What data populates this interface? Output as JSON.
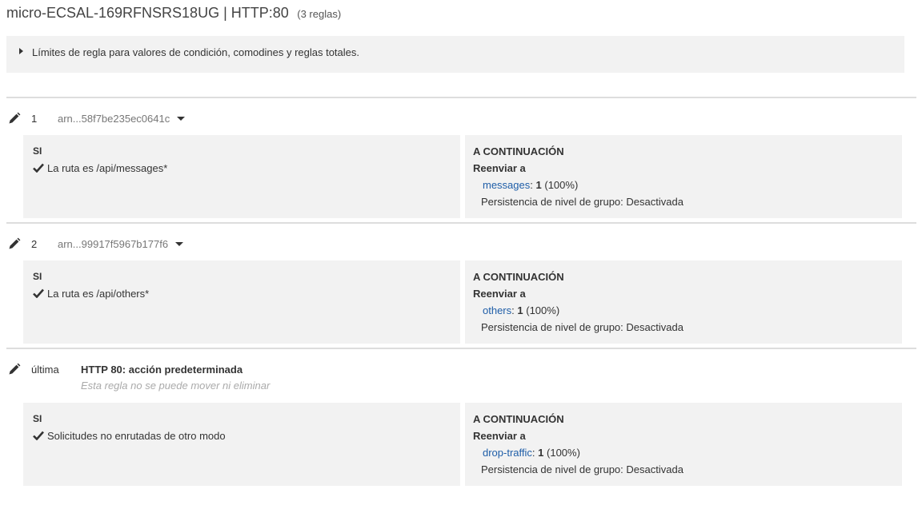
{
  "header": {
    "title": "micro-ECSAL-169RFNSRS18UG | HTTP:80",
    "rules_count": "(3 reglas)"
  },
  "limits": {
    "text": "Límites de regla para valores de condición, comodines y reglas totales.",
    "icon": "caret-right-icon"
  },
  "labels": {
    "if": "SI",
    "then": "A CONTINUACIÓN",
    "forward": "Reenviar a",
    "separator": ":"
  },
  "rules": [
    {
      "number": "1",
      "arn": "arn...58f7be235ec0641c",
      "condition": "La ruta es /api/messages*",
      "target_name": "messages",
      "target_weight": "1",
      "target_percent": "(100%)",
      "stickiness": "Persistencia de nivel de grupo: Desactivada"
    },
    {
      "number": "2",
      "arn": "arn...99917f5967b177f6",
      "condition": "La ruta es /api/others*",
      "target_name": "others",
      "target_weight": "1",
      "target_percent": "(100%)",
      "stickiness": "Persistencia de nivel de grupo: Desactivada"
    }
  ],
  "default_rule": {
    "number": "última",
    "title": "HTTP 80: acción predeterminada",
    "note": "Esta regla no se puede mover ni eliminar",
    "condition": "Solicitudes no enrutadas de otro modo",
    "target_name": "drop-traffic",
    "target_weight": "1",
    "target_percent": "(100%)",
    "stickiness": "Persistencia de nivel de grupo: Desactivada"
  },
  "icons": {
    "edit": "pencil-icon",
    "dropdown": "caret-down-icon",
    "check": "check-icon"
  },
  "colors": {
    "link": "#1f5ea8",
    "panel_bg": "#f2f2f2",
    "muted": "#777777"
  }
}
